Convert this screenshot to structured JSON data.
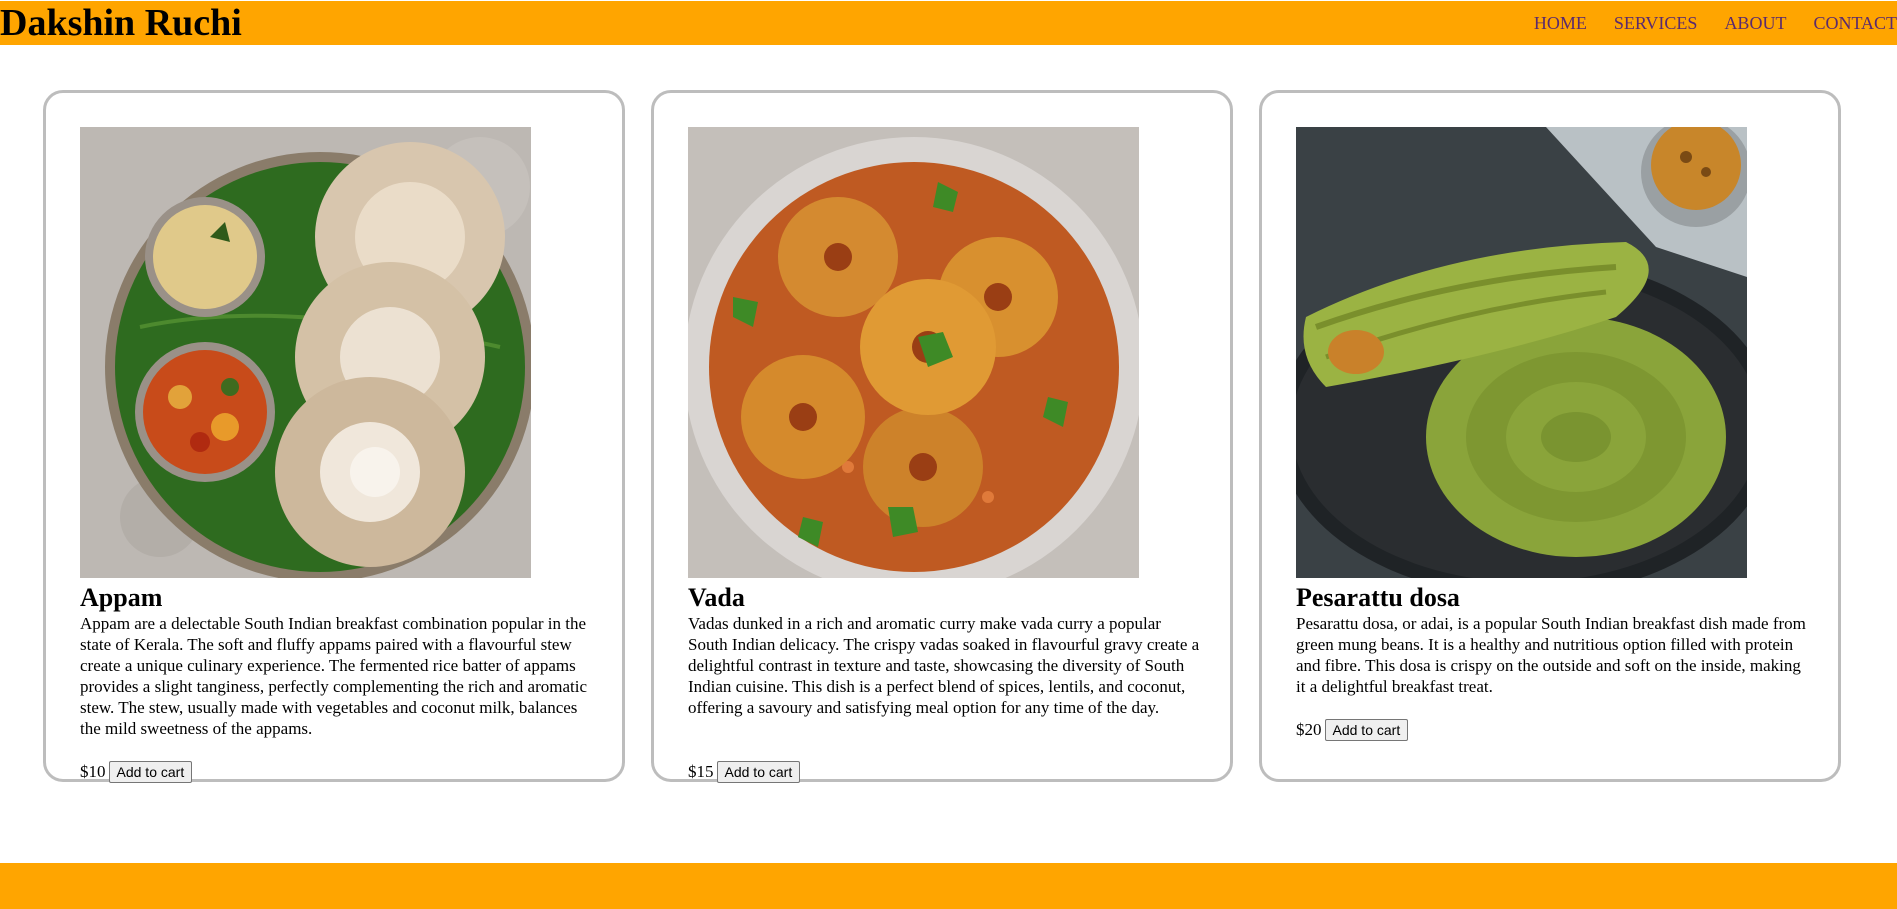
{
  "header": {
    "brand": "Dakshin Ruchi",
    "nav": [
      "HOME",
      "SERVICES",
      "ABOUT",
      "CONTACT"
    ]
  },
  "cards": [
    {
      "title": "Appam",
      "description": "Appam are a delectable South Indian breakfast combination popular in the state of Kerala. The soft and fluffy appams paired with a flavourful stew create a unique culinary experience. The fermented rice batter of appams provides a slight tanginess, perfectly complementing the rich and aromatic stew. The stew, usually made with vegetables and coconut milk, balances the mild sweetness of the appams.",
      "price": "$10",
      "button": "Add to cart"
    },
    {
      "title": "Vada",
      "description": "Vadas dunked in a rich and aromatic curry make vada curry a popular South Indian delicacy. The crispy vadas soaked in flavourful gravy create a delightful contrast in texture and taste, showcasing the diversity of South Indian cuisine. This dish is a perfect blend of spices, lentils, and coconut, offering a savoury and satisfying meal option for any time of the day.",
      "price": "$15",
      "button": "Add to cart"
    },
    {
      "title": "Pesarattu dosa",
      "description": "Pesarattu dosa, or adai, is a popular South Indian breakfast dish made from green mung beans. It is a healthy and nutritious option filled with protein and fibre. This dosa is crispy on the outside and soft on the inside, making it a delightful breakfast treat.",
      "price": "$20",
      "button": "Add to cart"
    }
  ],
  "colors": {
    "header_bg": "#ffa500",
    "footer_bg": "#ffa500",
    "nav_link": "#5a2a6e",
    "card_border": "#bdbdbd"
  }
}
